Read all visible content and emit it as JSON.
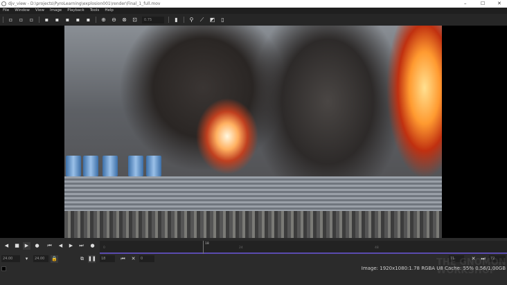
{
  "window": {
    "title": "djv_view - D:\\projects\\PyroLearning\\explosion001\\render\\Final_1_full.mov",
    "min": "–",
    "max": "☐",
    "close": "✕"
  },
  "menu": [
    "File",
    "Window",
    "View",
    "Image",
    "Playback",
    "Tools",
    "Help"
  ],
  "toolbar": {
    "zoom_value": "0.75"
  },
  "timeline": {
    "ticks": [
      "0",
      "24",
      "48"
    ],
    "current": "18"
  },
  "playback": {
    "speed": "24.00",
    "default_speed": "24.00",
    "frame": "18",
    "in_point": "0",
    "out_point_start": "71",
    "out_point_end": "72"
  },
  "status": "Image: 1920x1080:1.78 RGBA U8  Cache: 55% 0.56/1.00GB",
  "watermark": "THE GNOMON WORKSHOP"
}
